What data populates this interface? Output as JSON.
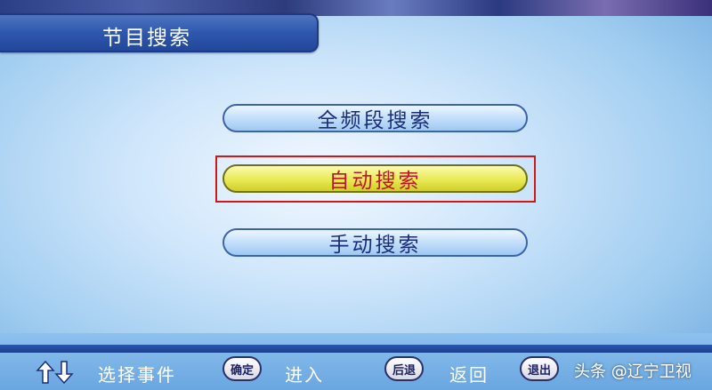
{
  "title": "节目搜索",
  "menu": {
    "full_band": "全频段搜索",
    "auto": "自动搜索",
    "manual": "手动搜索",
    "selected": "auto"
  },
  "footer": {
    "nav_icon": "up-down-arrows-icon",
    "select_label": "选择事件",
    "ok_key": "确定",
    "enter_label": "进入",
    "back_key": "后退",
    "back_label": "返回",
    "exit_key": "退出"
  },
  "watermark": "头条 @辽宁卫视",
  "colors": {
    "title_bar": "#2e57ad",
    "selected_item": "#e9e955",
    "selected_text": "#c0152a",
    "focus_frame": "#d01818",
    "item_text": "#1b2d7a"
  }
}
